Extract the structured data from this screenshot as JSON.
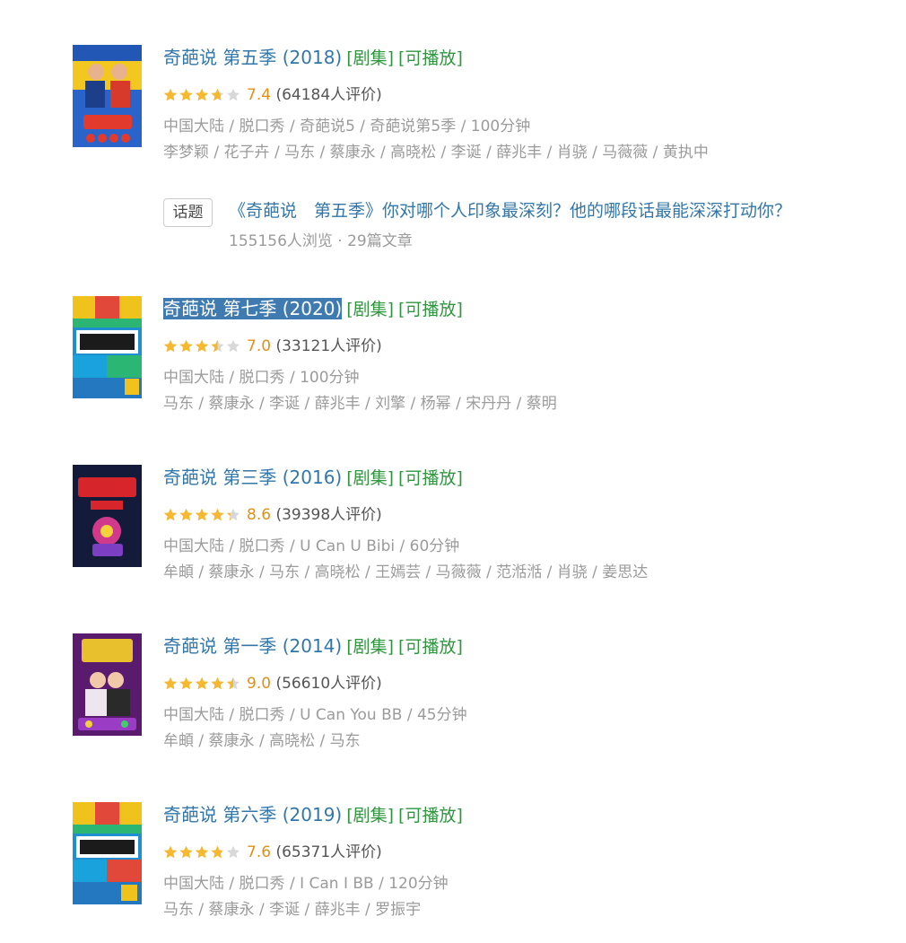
{
  "items": [
    {
      "title": "奇葩说 第五季 (2018)",
      "tag_series": "[剧集]",
      "tag_playable": "[可播放]",
      "rating": 7.4,
      "score_text": "7.4",
      "votes_text": "(64184人评价)",
      "meta": "中国大陆 / 脱口秀 / 奇葩说5 / 奇葩说第5季 / 100分钟",
      "cast": "李梦颖 / 花子卉 / 马东 / 蔡康永 / 高晓松 / 李诞 / 薛兆丰 / 肖骁 / 马薇薇 / 黄执中",
      "selected": false
    },
    {
      "title": "奇葩说 第七季 (2020)",
      "tag_series": "[剧集]",
      "tag_playable": "[可播放]",
      "rating": 7.0,
      "score_text": "7.0",
      "votes_text": "(33121人评价)",
      "meta": "中国大陆 / 脱口秀 / 100分钟",
      "cast": "马东 / 蔡康永 / 李诞 / 薛兆丰 / 刘擎 / 杨幂 / 宋丹丹 / 蔡明",
      "selected": true
    },
    {
      "title": "奇葩说 第三季 (2016)",
      "tag_series": "[剧集]",
      "tag_playable": "[可播放]",
      "rating": 8.6,
      "score_text": "8.6",
      "votes_text": "(39398人评价)",
      "meta": "中国大陆 / 脱口秀 / U Can U Bibi / 60分钟",
      "cast": "牟頔 / 蔡康永 / 马东 / 高晓松 / 王嫣芸 / 马薇薇 / 范湉湉 / 肖骁 / 姜思达",
      "selected": false
    },
    {
      "title": "奇葩说 第一季 (2014)",
      "tag_series": "[剧集]",
      "tag_playable": "[可播放]",
      "rating": 9.0,
      "score_text": "9.0",
      "votes_text": "(56610人评价)",
      "meta": "中国大陆 / 脱口秀 / U Can You BB / 45分钟",
      "cast": "牟頔 / 蔡康永 / 高晓松 / 马东",
      "selected": false
    },
    {
      "title": "奇葩说 第六季 (2019)",
      "tag_series": "[剧集]",
      "tag_playable": "[可播放]",
      "rating": 7.6,
      "score_text": "7.6",
      "votes_text": "(65371人评价)",
      "meta": "中国大陆 / 脱口秀 / I Can I BB / 120分钟",
      "cast": "马东 / 蔡康永 / 李诞 / 薛兆丰 / 罗振宇",
      "selected": false
    }
  ],
  "topic": {
    "badge": "话题",
    "title": "《奇葩说　第五季》你对哪个人印象最深刻？他的哪段话最能深深打动你？",
    "stats": "155156人浏览 · 29篇文章"
  },
  "colors": {
    "link": "#3377aa",
    "tag": "#2e963d",
    "score": "#e09015",
    "star": "#f5b82e",
    "star_empty": "#d8d8d8",
    "meta": "#9b9b9b",
    "selection": "#3f7bb0"
  }
}
